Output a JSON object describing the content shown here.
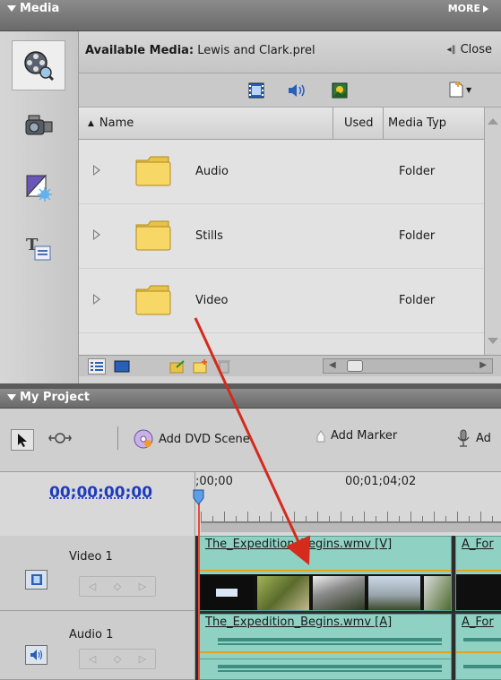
{
  "media_panel": {
    "title": "Media",
    "more_label": "MORE",
    "available_media_prefix": "Available Media:",
    "project_file": "Lewis and Clark.prel",
    "close_label": "Close",
    "columns": {
      "name": "Name",
      "used": "Used",
      "media_type": "Media Typ"
    },
    "items": [
      {
        "name": "Audio",
        "type": "Folder"
      },
      {
        "name": "Stills",
        "type": "Folder"
      },
      {
        "name": "Video",
        "type": "Folder"
      }
    ],
    "side_buttons": [
      "organize-icon",
      "camera-icon",
      "effects-icon",
      "titles-icon"
    ]
  },
  "project_panel": {
    "title": "My Project",
    "toolbar": {
      "add_dvd_scene": "Add DVD Scene",
      "add_marker": "Add Marker",
      "add_narration": "Ad"
    },
    "timecode": "00;00;00;00",
    "ruler_labels": [
      ";00;00",
      "00;01;04;02"
    ],
    "tracks": [
      {
        "name": "Video 1",
        "clips": [
          "The_Expedition_Begins.wmv [V]",
          "A_For"
        ]
      },
      {
        "name": "Audio 1",
        "clips": [
          "The_Expedition_Begins.wmv [A]",
          "A_For"
        ]
      }
    ]
  },
  "colors": {
    "clip_fill": "#8fd2c4",
    "playhead": "#e84a3a",
    "timecode": "#1d3bbf",
    "arrow": "#d52a1c"
  }
}
